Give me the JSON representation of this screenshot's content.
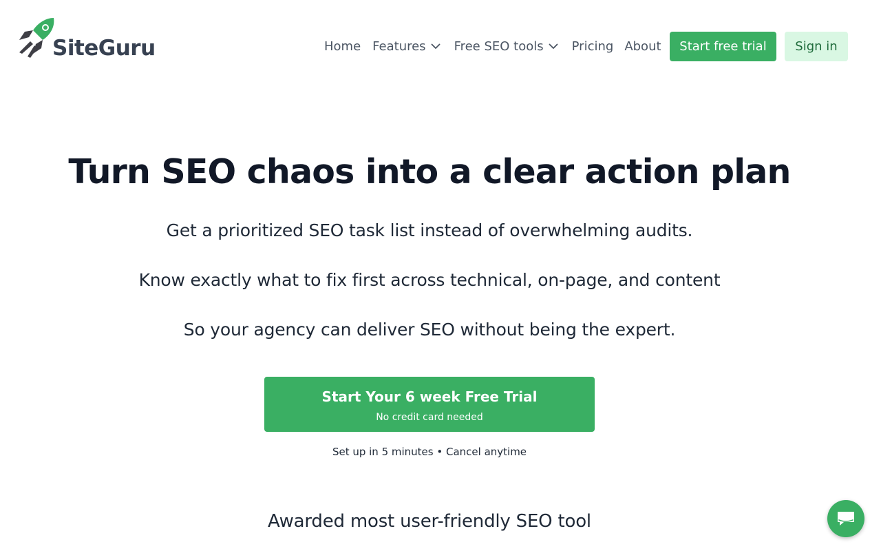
{
  "brand": {
    "name": "SiteGuru",
    "logo_icon": "rocket-icon",
    "accent_color": "#3aaf63",
    "accent_light": "#d9f7e3"
  },
  "nav": {
    "items": [
      {
        "label": "Home",
        "has_dropdown": false
      },
      {
        "label": "Features",
        "has_dropdown": true
      },
      {
        "label": "Free SEO tools",
        "has_dropdown": true
      },
      {
        "label": "Pricing",
        "has_dropdown": false
      },
      {
        "label": "About",
        "has_dropdown": false
      }
    ],
    "trial_label": "Start free trial",
    "signin_label": "Sign in"
  },
  "hero": {
    "title": "Turn SEO chaos into a clear action plan",
    "lines": [
      "Get a prioritized SEO task list instead of overwhelming audits.",
      "Know exactly what to fix first across technical, on-page, and content",
      "So your agency can deliver SEO without being the expert."
    ],
    "cta_label": "Start Your 6 week Free Trial",
    "cta_sublabel": "No credit card needed",
    "cta_note": "Set up in 5 minutes • Cancel anytime"
  },
  "award": {
    "text": "Awarded most user-friendly SEO tool"
  },
  "chat": {
    "icon": "chat-bubble-icon"
  }
}
